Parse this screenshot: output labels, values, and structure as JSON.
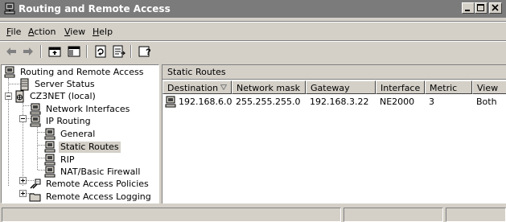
{
  "window": {
    "title": "Routing and Remote Access"
  },
  "menu": {
    "file": "File",
    "action": "Action",
    "view": "View",
    "help": "Help"
  },
  "toolbar": {
    "buttons": [
      "back-icon",
      "forward-icon",
      "up-folder-icon",
      "show-hide-tree-icon",
      "refresh-icon",
      "export-list-icon",
      "help-icon"
    ]
  },
  "tree": {
    "root": "Routing and Remote Access",
    "server_status": "Server Status",
    "server": "CZ3NET (local)",
    "network_interfaces": "Network Interfaces",
    "ip_routing": "IP Routing",
    "general": "General",
    "static_routes": "Static Routes",
    "rip": "RIP",
    "nat": "NAT/Basic Firewall",
    "policies": "Remote Access Policies",
    "logging": "Remote Access Logging"
  },
  "right_pane": {
    "title": "Static Routes",
    "columns": [
      "Destination",
      "Network mask",
      "Gateway",
      "Interface",
      "Metric",
      "View"
    ],
    "rows": [
      {
        "destination": "192.168.6.0",
        "mask": "255.255.255.0",
        "gateway": "192.168.3.22",
        "interface": "NE2000",
        "metric": "3",
        "view": "Both"
      }
    ]
  },
  "colors": {
    "titlebar": "#7b7b7b",
    "face": "#d4d0c8",
    "window": "#ffffff"
  }
}
